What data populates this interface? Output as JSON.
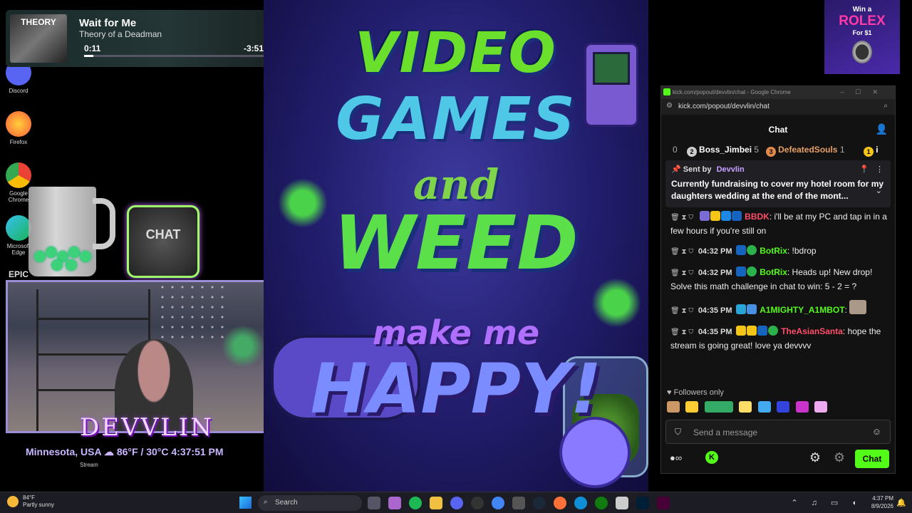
{
  "desktop": {
    "icons": [
      {
        "label": "Discord",
        "color": "#5865f2"
      },
      {
        "label": "Firefox",
        "color": "#ff7139"
      },
      {
        "label": "Google Chrome",
        "color": "#4285f4"
      },
      {
        "label": "Microsoft Edge",
        "color": "#0f8fd6"
      },
      {
        "label": "EPIC",
        "color": "#333333"
      }
    ]
  },
  "media": {
    "album_art_text": "THEORY",
    "title": "Wait for Me",
    "artist": "Theory of a Deadman",
    "elapsed": "0:11",
    "remaining": "-3:51",
    "progress_fraction": 0.05
  },
  "overlay": {
    "chat_logo_text": "CHAT",
    "streamer_name": "DEVVLIN",
    "weather": "Minnesota, USA ☁ 86°F / 30°C  4:37:51 PM",
    "stream_label": "Stream"
  },
  "poster": {
    "line1": "VIDEO",
    "line2": "GAMES",
    "line3": "and",
    "line4": "WEED",
    "line5": "make me",
    "line6": "HAPPY!"
  },
  "ad": {
    "line1": "Win a",
    "brand": "ROLEX",
    "line3": "For $1"
  },
  "chat_window": {
    "window_title": "kick.com/popout/devvlin/chat - Google Chrome",
    "url": "kick.com/popout/devvlin/chat",
    "header": "Chat",
    "leaderboard": [
      {
        "rank": "0",
        "name": "",
        "count": ""
      },
      {
        "rank": "2",
        "name": "Boss_Jimbei",
        "count": "5"
      },
      {
        "rank": "3",
        "name": "DefeatedSouls",
        "count": "1"
      },
      {
        "rank": "1",
        "name": "i",
        "count": ""
      }
    ],
    "pinned": {
      "sent_by_label": "Sent by",
      "sender": "Devvlin",
      "text": "Currently fundraising to cover my hotel room for my daughters wedding at the end of the mont..."
    },
    "messages": [
      {
        "time": "",
        "user": "BBDK",
        "user_color": "#ff4d6a",
        "text": ": i'll be at my PC and tap in in a few hours if you're still on"
      },
      {
        "time": "04:32 PM",
        "user": "BotRix",
        "user_color": "#53fc18",
        "text": ": !bdrop"
      },
      {
        "time": "04:32 PM",
        "user": "BotRix",
        "user_color": "#53fc18",
        "text": ":          Heads up! New drop!          Solve this math challenge in chat to win: 5 - 2 = ?"
      },
      {
        "time": "04:35 PM",
        "user": "A1MIGHTY_A1MBOT",
        "user_color": "#53fc18",
        "text": ":"
      },
      {
        "time": "04:35 PM",
        "user": "TheAsianSanta",
        "user_color": "#ff4d6a",
        "text": ": hope the stream is going great! love ya devvvv"
      }
    ],
    "followers_only": "Followers only",
    "input_placeholder": "Send a message",
    "chat_button": "Chat",
    "accent": "#53fc18"
  },
  "taskbar": {
    "weather_temp": "84°F",
    "weather_desc": "Partly sunny",
    "search_placeholder": "Search",
    "time": "4:37 PM",
    "date": "8/9/2026"
  }
}
